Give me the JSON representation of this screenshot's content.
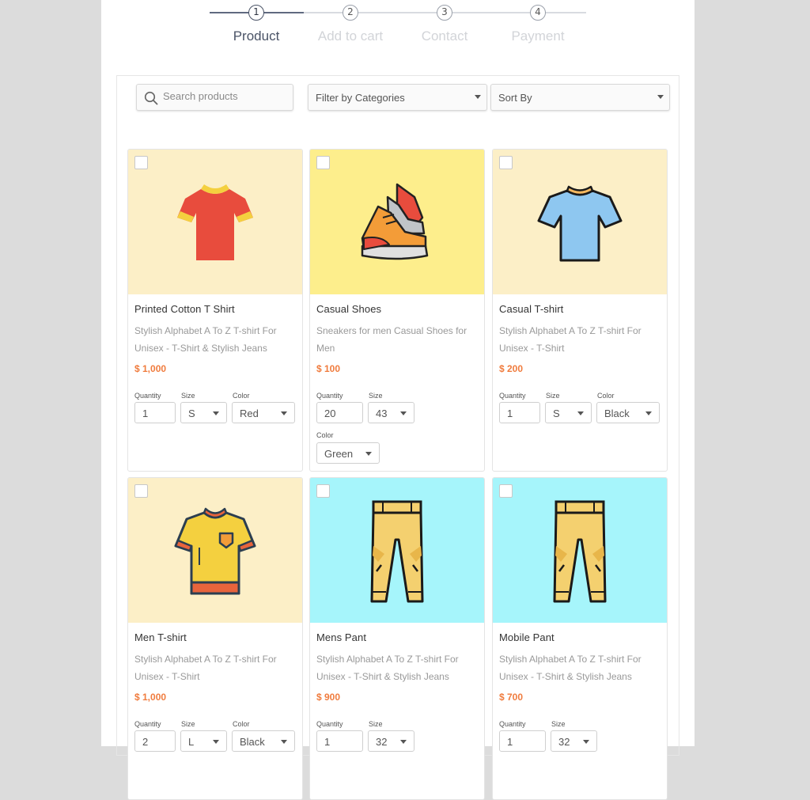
{
  "stepper": {
    "steps": [
      {
        "num": "1",
        "label": "Product"
      },
      {
        "num": "2",
        "label": "Add to cart"
      },
      {
        "num": "3",
        "label": "Contact"
      },
      {
        "num": "4",
        "label": "Payment"
      }
    ],
    "active_step": 1
  },
  "toolbar": {
    "search_placeholder": "Search products",
    "filter_label": "Filter by Categories",
    "sort_label": "Sort By"
  },
  "labels": {
    "quantity": "Quantity",
    "size": "Size",
    "color": "Color"
  },
  "products": [
    {
      "name": "Printed Cotton T Shirt",
      "desc": "Stylish Alphabet A To Z T-shirt For Unisex - T-Shirt & Stylish Jeans",
      "price": "$ 1,000",
      "quantity": "1",
      "size": "S",
      "color": "Red",
      "bg": "#fcefc7",
      "icon": "tshirt-icon"
    },
    {
      "name": "Casual Shoes",
      "desc": "Sneakers for men Casual Shoes for Men",
      "price": "$ 100",
      "quantity": "20",
      "size": "43",
      "color": "Green",
      "bg": "#fdee8c",
      "icon": "sneakers-icon"
    },
    {
      "name": "Casual T-shirt",
      "desc": "Stylish Alphabet A To Z T-shirt For Unisex - T-Shirt",
      "price": "$ 200",
      "quantity": "1",
      "size": "S",
      "color": "Black",
      "bg": "#fcefc7",
      "icon": "tshirt-icon"
    },
    {
      "name": "Men T-shirt",
      "desc": "Stylish Alphabet A To Z T-shirt For Unisex - T-Shirt",
      "price": "$ 1,000",
      "quantity": "2",
      "size": "L",
      "color": "Black",
      "bg": "#fcefc7",
      "icon": "tshirt-pocket-icon"
    },
    {
      "name": "Mens Pant",
      "desc": "Stylish Alphabet A To Z T-shirt For Unisex - T-Shirt & Stylish Jeans",
      "price": "$ 900",
      "quantity": "1",
      "size": "32",
      "bg": "#a6f5fb",
      "icon": "pants-icon"
    },
    {
      "name": "Mobile Pant",
      "desc": "Stylish Alphabet A To Z T-shirt For Unisex - T-Shirt & Stylish Jeans",
      "price": "$ 700",
      "quantity": "1",
      "size": "32",
      "bg": "#a6f5fb",
      "icon": "pants-icon"
    }
  ]
}
